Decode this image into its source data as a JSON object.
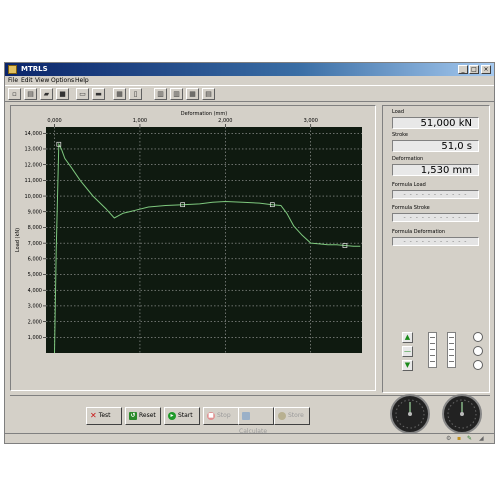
{
  "window": {
    "title": "MTRLS"
  },
  "menu": [
    "File",
    "Edit",
    "View",
    "Options",
    "Help"
  ],
  "toolbar": {
    "icons": [
      "new-file-icon",
      "open-file-icon",
      "open-folder-icon",
      "save-icon",
      "print-preview-icon",
      "print-icon",
      "export-icon",
      "page-icon",
      "view-1-icon",
      "view-2-icon",
      "view-3-icon",
      "view-4-icon"
    ]
  },
  "readouts": {
    "load_label": "Load",
    "load_value": "51,000 kN",
    "stroke_label": "Stroke",
    "stroke_value": "51,0 s",
    "deformation_label": "Deformation",
    "deformation_value": "1,530 mm",
    "formula_load_label": "Formula Load",
    "formula_load_value": "- - - - - - - - - - -",
    "formula_stroke_label": "Formula Stroke",
    "formula_stroke_value": "- - - - - - - - - - -",
    "formula_deformation_label": "Formula Deformation",
    "formula_deformation_value": "- - - - - - - - - - -"
  },
  "buttons": {
    "test": "Test",
    "reset": "Reset",
    "start": "Start",
    "stop": "Stop",
    "calculate": "Calculate",
    "store": "Store"
  },
  "chart_data": {
    "type": "line",
    "title": "Deformation (mm)",
    "xlabel": "Deformation (mm)",
    "ylabel": "Load (kN)",
    "xlim": [
      -0.1,
      3.6
    ],
    "ylim": [
      0,
      14400
    ],
    "x_ticks": [
      "0,000",
      "1,000",
      "2,000",
      "3,000"
    ],
    "x_tick_values": [
      0,
      1,
      2,
      3
    ],
    "y_ticks": [
      "1,000",
      "2,000",
      "3,000",
      "4,000",
      "5,000",
      "6,000",
      "7,000",
      "8,000",
      "9,000",
      "10,000",
      "11,000",
      "12,000",
      "13,000",
      "14,000"
    ],
    "y_tick_values": [
      1000,
      2000,
      3000,
      4000,
      5000,
      6000,
      7000,
      8000,
      9000,
      10000,
      11000,
      12000,
      13000,
      14000
    ],
    "grid": true,
    "background": "#0f1a10",
    "line_color": "#7ec87e",
    "series": [
      {
        "x": [
          0.0,
          0.02,
          0.05,
          0.08,
          0.12,
          0.2,
          0.3,
          0.45,
          0.6,
          0.7,
          0.8,
          0.95,
          1.1,
          1.3,
          1.5,
          1.7,
          1.85,
          2.0,
          2.2,
          2.4,
          2.55,
          2.65,
          2.72,
          2.8,
          2.9,
          3.0,
          3.1,
          3.2,
          3.3,
          3.4,
          3.5,
          3.58
        ],
        "y": [
          0,
          6500,
          13300,
          13000,
          12400,
          11800,
          11000,
          10000,
          9200,
          8600,
          8900,
          9100,
          9300,
          9400,
          9450,
          9500,
          9600,
          9650,
          9600,
          9550,
          9450,
          9400,
          8900,
          8100,
          7500,
          7000,
          6950,
          6900,
          6900,
          6850,
          6800,
          6800
        ]
      }
    ],
    "markers": [
      {
        "x": 0.05,
        "y": 13300
      },
      {
        "x": 1.5,
        "y": 9450
      },
      {
        "x": 2.55,
        "y": 9450
      },
      {
        "x": 3.4,
        "y": 6850
      }
    ]
  }
}
